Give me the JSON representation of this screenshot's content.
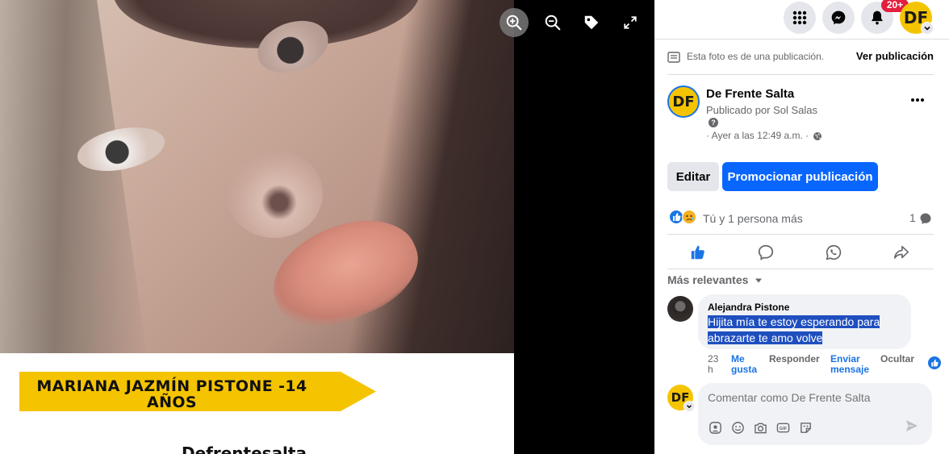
{
  "photo": {
    "name_banner": "MARIANA JAZMÍN PISTONE -14 AÑOS",
    "caption_partial": "Defrentesalta"
  },
  "viewer_toolbar": {
    "zoom_in": "zoom-in-icon",
    "zoom_out": "zoom-out-icon",
    "tag": "tag-icon",
    "fullscreen": "fullscreen-icon"
  },
  "topnav": {
    "menu_icon": "grid-menu-icon",
    "messenger_icon": "messenger-icon",
    "notifications_icon": "bell-icon",
    "notifications_badge": "20+",
    "account_initials": "DF"
  },
  "publication_note": {
    "text": "Esta foto es de una publicación.",
    "link": "Ver publicación"
  },
  "post": {
    "page_name": "De Frente Salta",
    "published_by": "Publicado por Sol Salas",
    "help_mark": "?",
    "time": "· Ayer a las 12:49 a.m. ·",
    "avatar_initials": "DF",
    "edit_label": "Editar",
    "promote_label": "Promocionar publicación",
    "reactions_text": "Tú y 1 persona más",
    "comment_count": "1"
  },
  "comments": {
    "sort_label": "Más relevantes",
    "items": [
      {
        "author": "Alejandra Pistone",
        "text": "Hijita mía te estoy esperando para abrazarte te amo volve",
        "time": "23 h",
        "like": "Me gusta",
        "reply": "Responder",
        "send_message": "Enviar mensaje",
        "hide": "Ocultar"
      }
    ]
  },
  "composer": {
    "placeholder": "Comentar como De Frente Salta",
    "avatar_initials": "DF"
  },
  "colors": {
    "accent": "#0866ff",
    "banner_yellow": "#f5c400",
    "badge_red": "#e41e3f"
  }
}
